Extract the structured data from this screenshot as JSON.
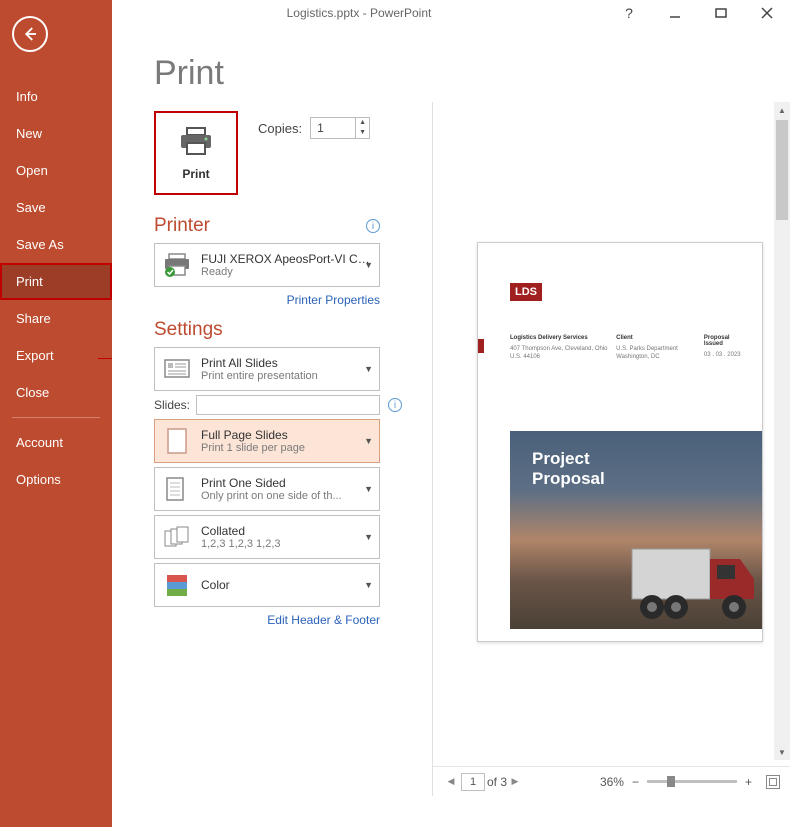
{
  "titlebar": {
    "title": "Logistics.pptx - PowerPoint"
  },
  "sidebar": {
    "items": [
      "Info",
      "New",
      "Open",
      "Save",
      "Save As",
      "Print",
      "Share",
      "Export",
      "Close"
    ],
    "bottom": [
      "Account",
      "Options"
    ],
    "selected": "Print"
  },
  "page": {
    "heading": "Print"
  },
  "print_button": {
    "label": "Print"
  },
  "copies": {
    "label": "Copies:",
    "value": "1"
  },
  "printer": {
    "heading": "Printer",
    "name": "FUJI XEROX ApeosPort-VI C3...",
    "status": "Ready",
    "properties_link": "Printer Properties"
  },
  "settings": {
    "heading": "Settings",
    "slides_label": "Slides:",
    "edit_hf": "Edit Header & Footer",
    "items": [
      {
        "title": "Print All Slides",
        "sub": "Print entire presentation"
      },
      {
        "title": "Full Page Slides",
        "sub": "Print 1 slide per page"
      },
      {
        "title": "Print One Sided",
        "sub": "Only print on one side of th..."
      },
      {
        "title": "Collated",
        "sub": "1,2,3    1,2,3    1,2,3"
      },
      {
        "title": "Color",
        "sub": ""
      }
    ]
  },
  "preview": {
    "lds": "LDS",
    "col1_h": "Logistics Delivery Services",
    "col1_t": "407 Thompson Ave,\nCleveland, Ohio U.S. 44106",
    "col2_h": "Client",
    "col2_t": "U.S. Parks Department\nWashington, DC",
    "col3_h": "Proposal Issued",
    "col3_t": "03 . 03 . 2023",
    "hero1": "Project",
    "hero2": "Proposal"
  },
  "status": {
    "page": "1",
    "of": "of 3",
    "zoom": "36%"
  }
}
